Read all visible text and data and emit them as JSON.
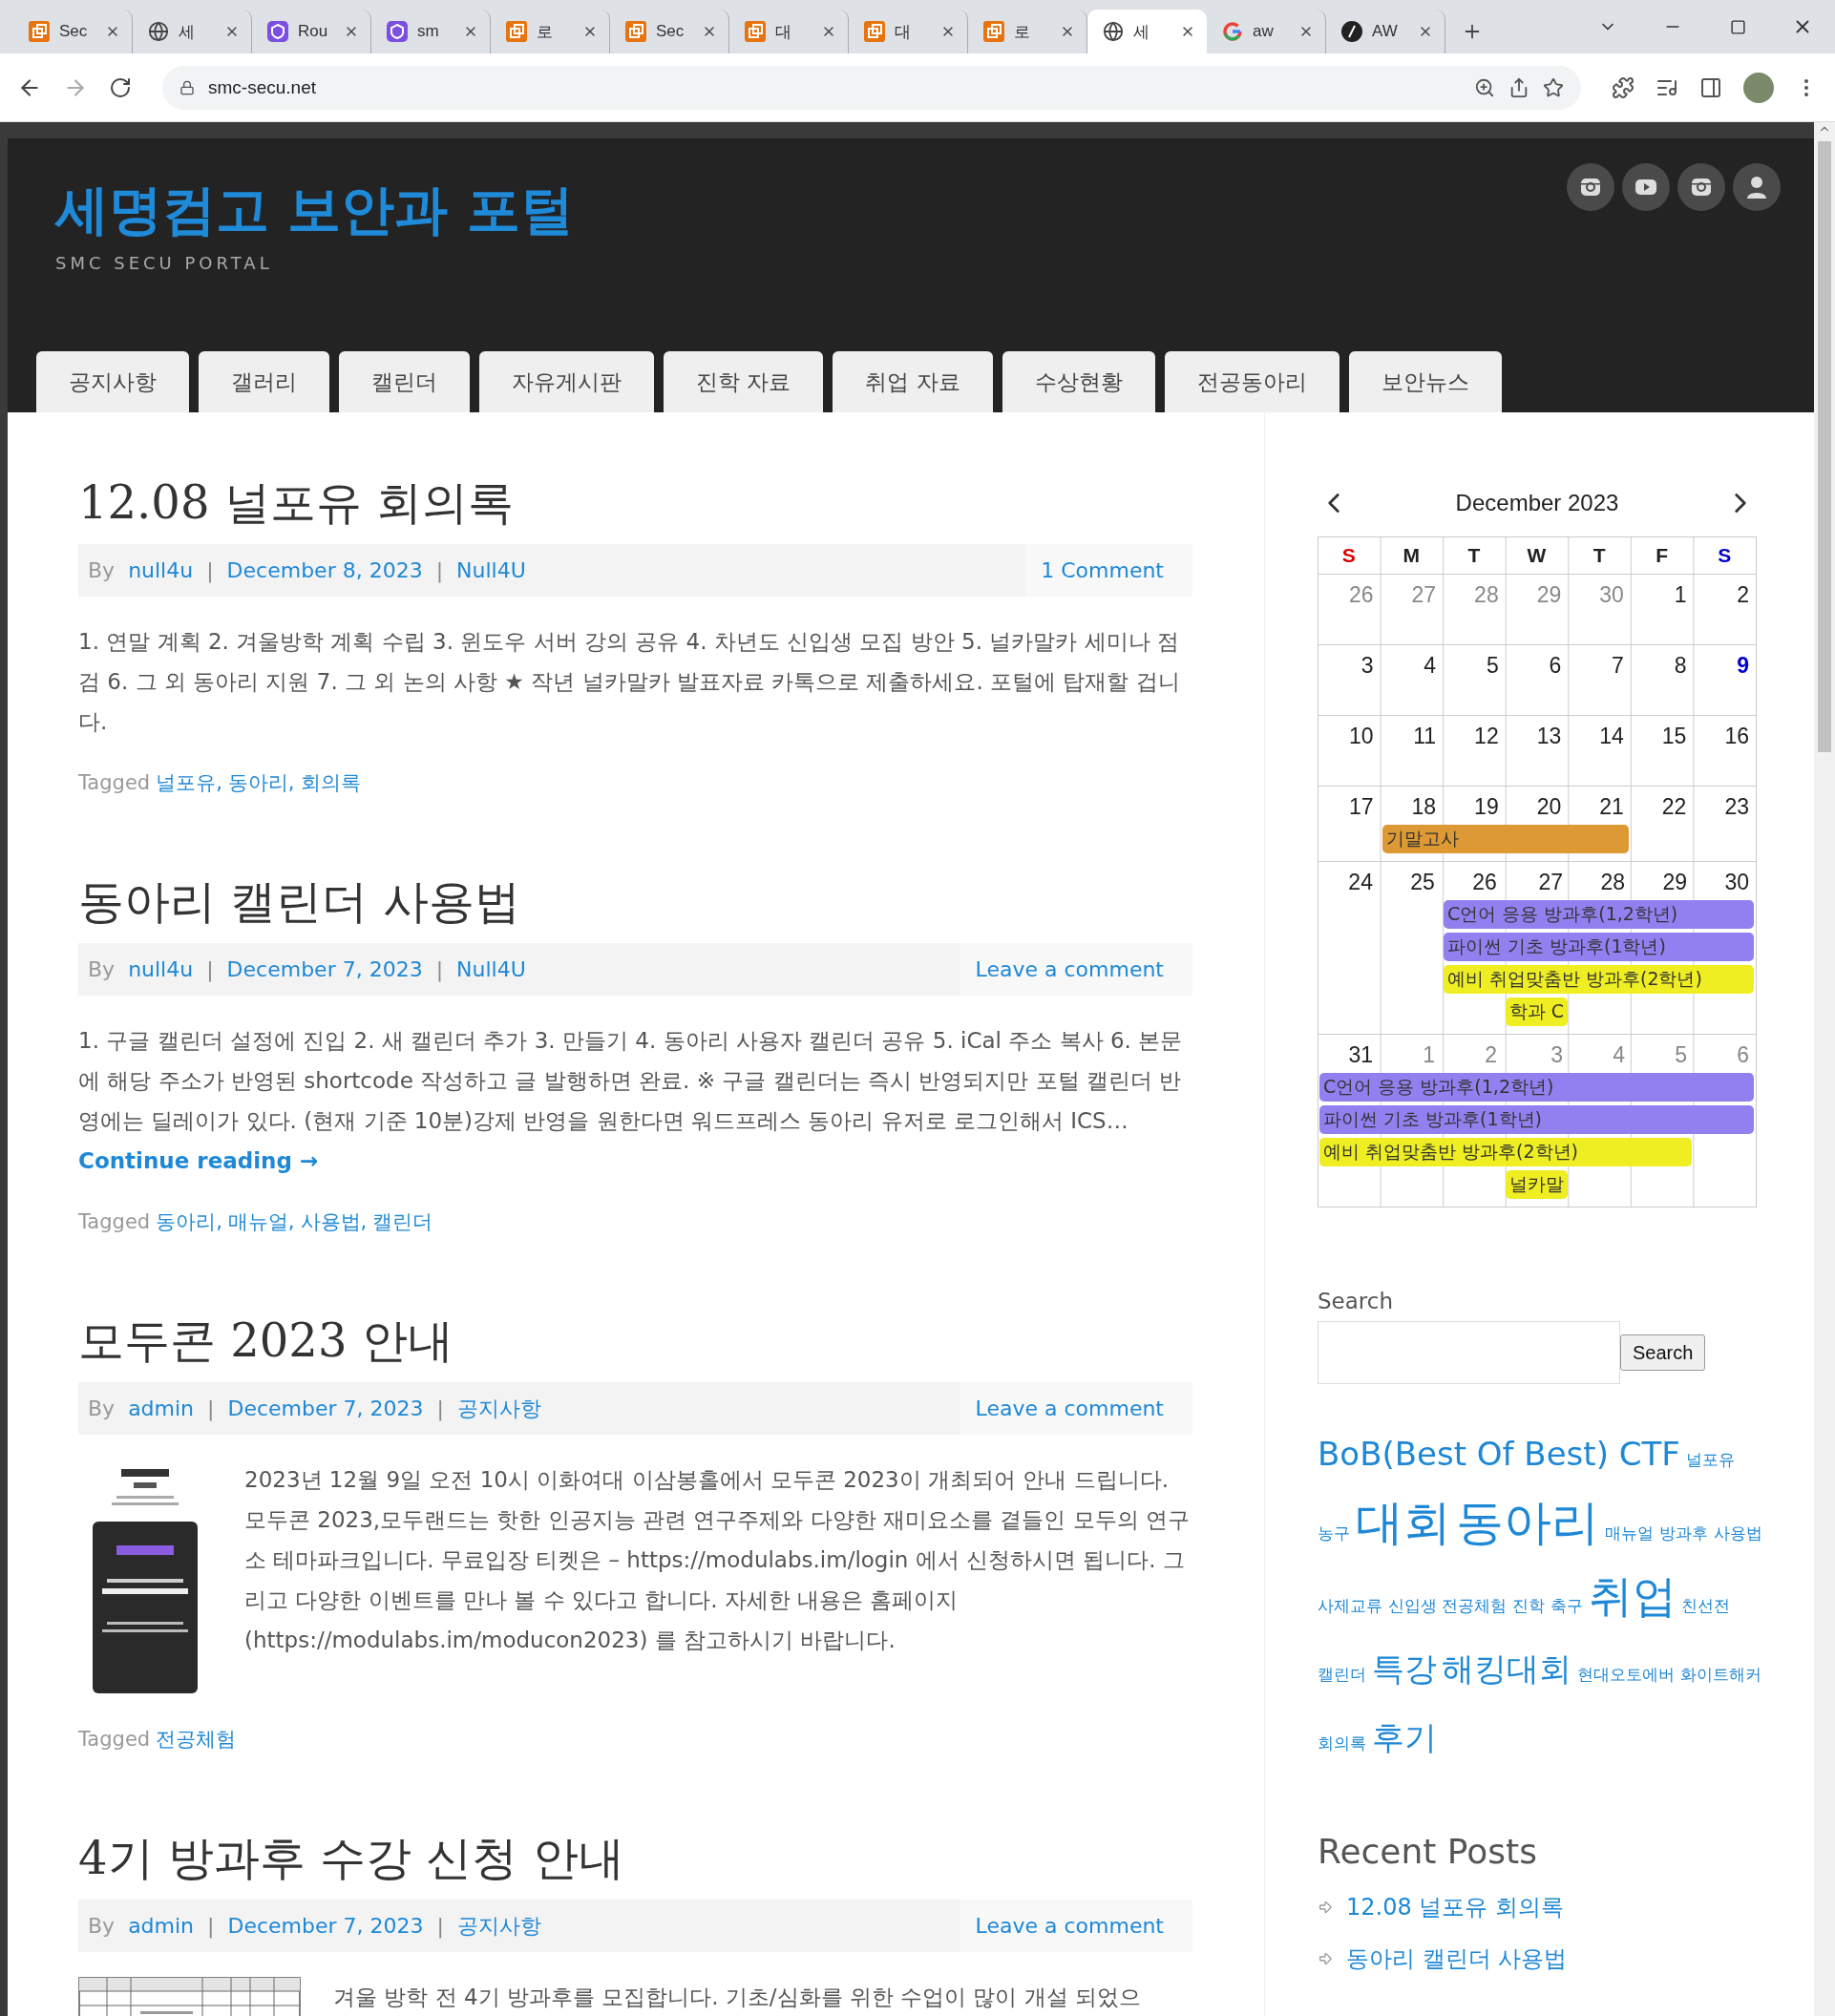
{
  "browser": {
    "tabs": [
      {
        "title": "Sec",
        "kind": "app",
        "selected": false
      },
      {
        "title": "세",
        "kind": "globe",
        "selected": false
      },
      {
        "title": "Rou",
        "kind": "shield",
        "selected": false
      },
      {
        "title": "sm",
        "kind": "shield",
        "selected": false
      },
      {
        "title": "로",
        "kind": "app",
        "selected": false
      },
      {
        "title": "Sec",
        "kind": "app",
        "selected": false
      },
      {
        "title": "대",
        "kind": "app",
        "selected": false
      },
      {
        "title": "대",
        "kind": "app",
        "selected": false
      },
      {
        "title": "로",
        "kind": "app",
        "selected": false
      },
      {
        "title": "세",
        "kind": "globe",
        "selected": true
      },
      {
        "title": "aw",
        "kind": "google",
        "selected": false
      },
      {
        "title": "AW",
        "kind": "feather",
        "selected": false
      }
    ],
    "url": "smc-secu.net"
  },
  "site": {
    "title": "세명컴고 보안과 포털",
    "tagline": "SMC SECU PORTAL",
    "social": [
      {
        "kind": "camera"
      },
      {
        "kind": "video"
      },
      {
        "kind": "camera"
      },
      {
        "kind": "user"
      }
    ],
    "nav": [
      "공지사항",
      "갤러리",
      "캘린더",
      "자유게시판",
      "진학 자료",
      "취업 자료",
      "수상현황",
      "전공동아리",
      "보안뉴스"
    ]
  },
  "posts": [
    {
      "title": "12.08 널포유 회의록",
      "by": "By",
      "author": "null4u",
      "sep": "|",
      "date": "December 8, 2023",
      "category": "Null4U",
      "comments": "1 Comment",
      "excerpt": "1. 연말 계획 2. 겨울방학 계획 수립 3. 윈도우 서버 강의 공유 4. 차년도 신입생 모집 방안 5. 널카말카 세미나 점검 6. 그 외 동아리 지원 7. 그 외 논의 사항 ★ 작년 널카말카 발표자료 카톡으로 제출하세요. 포털에 탑재할 겁니다.",
      "tagged": "Tagged",
      "tags": [
        "널포유,",
        "동아리,",
        "회의록"
      ]
    },
    {
      "title": "동아리 캘린더 사용법",
      "by": "By",
      "author": "null4u",
      "sep": "|",
      "date": "December 7, 2023",
      "category": "Null4U",
      "comments": "Leave a comment",
      "excerpt": "1. 구글 캘린더 설정에 진입 2. 새 캘린더 추가 3. 만들기 4. 동아리 사용자 캘린더 공유 5. iCal 주소 복사 6. 본문에 해당 주소가 반영된 shortcode 작성하고 글 발행하면 완료. ※ 구글 캘린더는 즉시 반영되지만 포털 캘린더 반영에는 딜레이가 있다. (현재 기준 10분)강제 반영을 원한다면 워드프레스 동아리 유저로 로그인해서 ICS…",
      "more": "Continue reading →",
      "tagged": "Tagged",
      "tags": [
        "동아리,",
        "매뉴얼,",
        "사용법,",
        "캘린더"
      ]
    },
    {
      "title": "모두콘 2023 안내",
      "by": "By",
      "author": "admin",
      "sep": "|",
      "date": "December 7, 2023",
      "category": "공지사항",
      "comments": "Leave a comment",
      "image": {
        "kind": "poster"
      },
      "excerpt": "2023년 12월 9일 오전 10시 이화여대 이삼봉홀에서 모두콘 2023이 개최되어 안내 드립니다. 모두콘 2023,모두랜드는 핫한 인공지능 관련 연구주제와 다양한 재미요소를 곁들인 모두의 연구소 테마파크입니다. 무료입장 티켓은 – https://modulabs.im/login 에서 신청하시면 됩니다. 그리고 다양한 이벤트를 만나 볼 수 있다고 합니다. 자세한 내용은 홈페이지(https://modulabs.im/moducon2023) 를 참고하시기 바랍니다.",
      "tagged": "Tagged",
      "tags": [
        "전공체험"
      ]
    },
    {
      "title": "4기 방과후 수강 신청 안내",
      "by": "By",
      "author": "admin",
      "sep": "|",
      "date": "December 7, 2023",
      "category": "공지사항",
      "comments": "Leave a comment",
      "image": {
        "kind": "table"
      },
      "excerpt": "겨울 방학 전 4기 방과후를 모집합니다. 기초/심화를 위한 수업이 많이 개설 되었으"
    }
  ],
  "sidebar": {
    "calendar": {
      "title": "December 2023",
      "weekdays": [
        {
          "label": "S",
          "color": "#dd0000"
        },
        {
          "label": "M",
          "color": "#222222"
        },
        {
          "label": "T",
          "color": "#222222"
        },
        {
          "label": "W",
          "color": "#222222"
        },
        {
          "label": "T",
          "color": "#222222"
        },
        {
          "label": "F",
          "color": "#222222"
        },
        {
          "label": "S",
          "color": "#0000cc"
        }
      ],
      "weeks": [
        {
          "days": [
            {
              "n": "26",
              "other": true,
              "today": false
            },
            {
              "n": "27",
              "other": true,
              "today": false
            },
            {
              "n": "28",
              "other": true,
              "today": false
            },
            {
              "n": "29",
              "other": true,
              "today": false
            },
            {
              "n": "30",
              "other": true,
              "today": false
            },
            {
              "n": "1",
              "other": false,
              "today": false
            },
            {
              "n": "2",
              "other": false,
              "today": false
            }
          ]
        },
        {
          "days": [
            {
              "n": "3",
              "other": false,
              "today": false
            },
            {
              "n": "4",
              "other": false,
              "today": false
            },
            {
              "n": "5",
              "other": false,
              "today": false
            },
            {
              "n": "6",
              "other": false,
              "today": false
            },
            {
              "n": "7",
              "other": false,
              "today": false
            },
            {
              "n": "8",
              "other": false,
              "today": false
            },
            {
              "n": "9",
              "other": false,
              "today": true
            }
          ]
        },
        {
          "days": [
            {
              "n": "10",
              "other": false,
              "today": false
            },
            {
              "n": "11",
              "other": false,
              "today": false
            },
            {
              "n": "12",
              "other": false,
              "today": false
            },
            {
              "n": "13",
              "other": false,
              "today": false
            },
            {
              "n": "14",
              "other": false,
              "today": false
            },
            {
              "n": "15",
              "other": false,
              "today": false
            },
            {
              "n": "16",
              "other": false,
              "today": false
            }
          ]
        },
        {
          "days": [
            {
              "n": "17",
              "other": false,
              "today": false
            },
            {
              "n": "18",
              "other": false,
              "today": false
            },
            {
              "n": "19",
              "other": false,
              "today": false
            },
            {
              "n": "20",
              "other": false,
              "today": false
            },
            {
              "n": "21",
              "other": false,
              "today": false
            },
            {
              "n": "22",
              "other": false,
              "today": false
            },
            {
              "n": "23",
              "other": false,
              "today": false
            }
          ],
          "lanes": [
            [
              {
                "kind": "empty"
              },
              {
                "kind": "event",
                "title": "기말고사",
                "color": "#dd9933"
              },
              {
                "kind": "cont"
              },
              {
                "kind": "cont"
              },
              {
                "kind": "cont"
              },
              {
                "kind": "empty"
              },
              {
                "kind": "empty"
              }
            ]
          ]
        },
        {
          "days": [
            {
              "n": "24",
              "other": false,
              "today": false
            },
            {
              "n": "25",
              "other": false,
              "today": false
            },
            {
              "n": "26",
              "other": false,
              "today": false
            },
            {
              "n": "27",
              "other": false,
              "today": false
            },
            {
              "n": "28",
              "other": false,
              "today": false
            },
            {
              "n": "29",
              "other": false,
              "today": false
            },
            {
              "n": "30",
              "other": false,
              "today": false
            }
          ],
          "lanes": [
            [
              {
                "kind": "empty"
              },
              {
                "kind": "empty"
              },
              {
                "kind": "event",
                "title": "C언어 응용 방과후(1,2학년)",
                "color": "#9380f0"
              },
              {
                "kind": "cont"
              },
              {
                "kind": "cont"
              },
              {
                "kind": "cont"
              },
              {
                "kind": "cont"
              }
            ],
            [
              {
                "kind": "empty"
              },
              {
                "kind": "empty"
              },
              {
                "kind": "event",
                "title": "파이썬 기초 방과후(1학년)",
                "color": "#9380f0"
              },
              {
                "kind": "cont"
              },
              {
                "kind": "cont"
              },
              {
                "kind": "cont"
              },
              {
                "kind": "cont"
              }
            ],
            [
              {
                "kind": "empty"
              },
              {
                "kind": "empty"
              },
              {
                "kind": "event",
                "title": "예비 취업맞춤반 방과후(2학년)",
                "color": "#eeee22"
              },
              {
                "kind": "cont"
              },
              {
                "kind": "cont"
              },
              {
                "kind": "cont"
              },
              {
                "kind": "cont"
              }
            ],
            [
              {
                "kind": "empty"
              },
              {
                "kind": "empty"
              },
              {
                "kind": "empty"
              },
              {
                "kind": "event",
                "title": "학과 C",
                "color": "#eeee22"
              },
              {
                "kind": "empty"
              },
              {
                "kind": "empty"
              },
              {
                "kind": "empty"
              }
            ]
          ]
        },
        {
          "days": [
            {
              "n": "31",
              "other": false,
              "today": false
            },
            {
              "n": "1",
              "other": true,
              "today": false
            },
            {
              "n": "2",
              "other": true,
              "today": false
            },
            {
              "n": "3",
              "other": true,
              "today": false
            },
            {
              "n": "4",
              "other": true,
              "today": false
            },
            {
              "n": "5",
              "other": true,
              "today": false
            },
            {
              "n": "6",
              "other": true,
              "today": false
            }
          ],
          "lanes": [
            [
              {
                "kind": "event",
                "title": "C언어 응용 방과후(1,2학년)",
                "color": "#9380f0"
              },
              {
                "kind": "cont"
              },
              {
                "kind": "cont"
              },
              {
                "kind": "cont"
              },
              {
                "kind": "cont"
              },
              {
                "kind": "cont"
              },
              {
                "kind": "cont"
              }
            ],
            [
              {
                "kind": "event",
                "title": "파이썬 기초 방과후(1학년)",
                "color": "#9380f0"
              },
              {
                "kind": "cont"
              },
              {
                "kind": "cont"
              },
              {
                "kind": "cont"
              },
              {
                "kind": "cont"
              },
              {
                "kind": "cont"
              },
              {
                "kind": "cont"
              }
            ],
            [
              {
                "kind": "event",
                "title": "예비 취업맞춤반 방과후(2학년)",
                "color": "#eeee22"
              },
              {
                "kind": "cont"
              },
              {
                "kind": "cont"
              },
              {
                "kind": "cont"
              },
              {
                "kind": "cont"
              },
              {
                "kind": "cont"
              },
              {
                "kind": "empty"
              }
            ],
            [
              {
                "kind": "empty"
              },
              {
                "kind": "empty"
              },
              {
                "kind": "empty"
              },
              {
                "kind": "event",
                "title": "널카말",
                "color": "#eeee22"
              },
              {
                "kind": "empty"
              },
              {
                "kind": "empty"
              },
              {
                "kind": "empty"
              }
            ]
          ]
        }
      ]
    },
    "search": {
      "label": "Search",
      "button": "Search"
    },
    "tag_cloud": [
      {
        "text": "BoB(Best Of Best) CTF",
        "kind": "medium"
      },
      {
        "text": "널포유",
        "kind": "small"
      },
      {
        "text": "농구",
        "kind": "small"
      },
      {
        "text": "대회",
        "kind": "huge"
      },
      {
        "text": "동아리",
        "kind": "huge"
      },
      {
        "text": "매뉴얼",
        "kind": "small"
      },
      {
        "text": "방과후",
        "kind": "small"
      },
      {
        "text": "사용법",
        "kind": "small"
      },
      {
        "text": "사제교류",
        "kind": "small"
      },
      {
        "text": "신입생",
        "kind": "small"
      },
      {
        "text": "전공체험",
        "kind": "small"
      },
      {
        "text": "진학",
        "kind": "small"
      },
      {
        "text": "축구",
        "kind": "small"
      },
      {
        "text": "취업",
        "kind": "large"
      },
      {
        "text": "친선전",
        "kind": "small"
      },
      {
        "text": "캘린더",
        "kind": "small"
      },
      {
        "text": "특강",
        "kind": "medium"
      },
      {
        "text": "해킹대회",
        "kind": "medium"
      },
      {
        "text": "현대오토에버",
        "kind": "small"
      },
      {
        "text": "화이트해커",
        "kind": "small"
      },
      {
        "text": "회의록",
        "kind": "small"
      },
      {
        "text": "후기",
        "kind": "medium"
      }
    ],
    "recent_posts": {
      "title": "Recent Posts",
      "items": [
        "12.08 널포유 회의록",
        "동아리 캘린더 사용법"
      ]
    }
  }
}
